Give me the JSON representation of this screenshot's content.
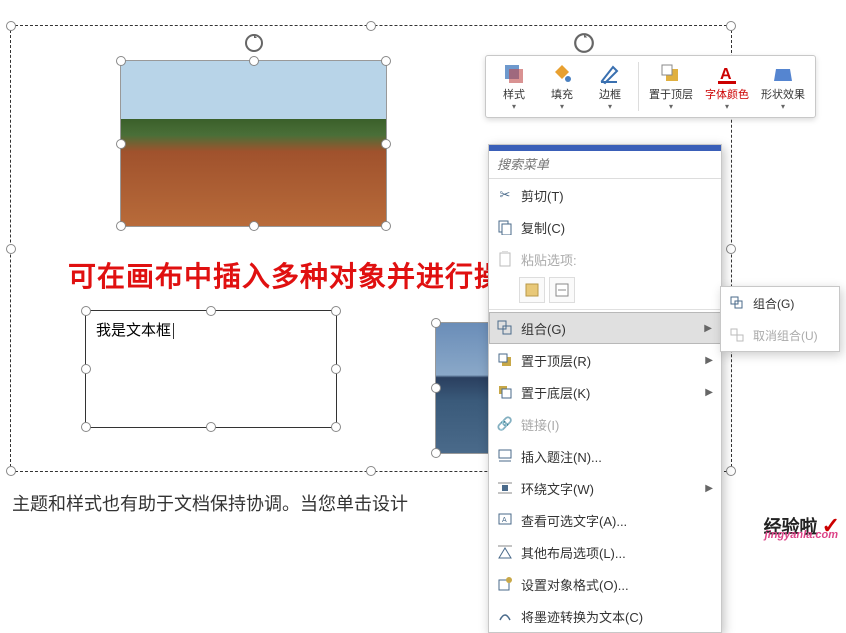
{
  "overlay_caption": "可在画布中插入多种对象并进行操作",
  "textbox_content": "我是文本框",
  "bottom_paragraph": "主题和样式也有助于文档保持协调。当您单击设计",
  "mini_toolbar": {
    "style": "样式",
    "fill": "填充",
    "outline": "边框",
    "bring_front": "置于顶层",
    "font_color": "字体颜色",
    "shape_effects": "形状效果"
  },
  "context_menu": {
    "search_placeholder": "搜索菜单",
    "cut": "剪切(T)",
    "copy": "复制(C)",
    "paste_options_label": "粘贴选项:",
    "group": "组合(G)",
    "bring_to_front": "置于顶层(R)",
    "send_to_back": "置于底层(K)",
    "link": "链接(I)",
    "insert_caption": "插入题注(N)...",
    "wrap_text": "环绕文字(W)",
    "view_alt_text": "查看可选文字(A)...",
    "more_layout": "其他布局选项(L)...",
    "format_object": "设置对象格式(O)...",
    "ink_to_text": "将墨迹转换为文本(C)"
  },
  "submenu": {
    "group": "组合(G)",
    "ungroup": "取消组合(U)"
  },
  "watermark": {
    "main": "经验啦",
    "sub": "jingyanla.com"
  }
}
